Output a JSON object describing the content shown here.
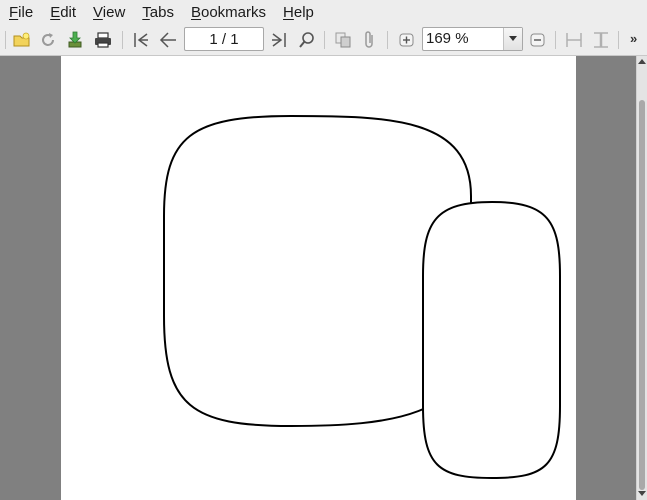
{
  "menubar": {
    "items": [
      {
        "label": "File",
        "mnemonic": "F",
        "rest": "ile"
      },
      {
        "label": "Edit",
        "mnemonic": "E",
        "rest": "dit"
      },
      {
        "label": "View",
        "mnemonic": "V",
        "rest": "iew"
      },
      {
        "label": "Tabs",
        "mnemonic": "T",
        "rest": "abs"
      },
      {
        "label": "Bookmarks",
        "mnemonic": "B",
        "rest": "ookmarks"
      },
      {
        "label": "Help",
        "mnemonic": "H",
        "rest": "elp"
      }
    ]
  },
  "toolbar": {
    "page_indicator": "1 / 1",
    "zoom_value": "169 %",
    "overflow": "»",
    "icons": [
      "open-folder-icon",
      "reload-icon",
      "save-download-icon",
      "print-icon",
      "first-page-icon",
      "previous-page-icon",
      "next-page-icon",
      "last-page-icon",
      "find-icon",
      "copy-icon",
      "attachment-icon",
      "zoom-in-icon",
      "zoom-out-icon",
      "fit-width-icon",
      "fit-page-icon"
    ]
  },
  "document": {
    "page_count": 1,
    "current_page": 1,
    "shapes": [
      "large-rounded-square",
      "small-rounded-rectangle"
    ]
  },
  "colors": {
    "chrome": "#ededed",
    "viewport_bg": "#808080",
    "page_bg": "#ffffff",
    "shape_stroke": "#000000",
    "accent_green": "#4caf50"
  }
}
